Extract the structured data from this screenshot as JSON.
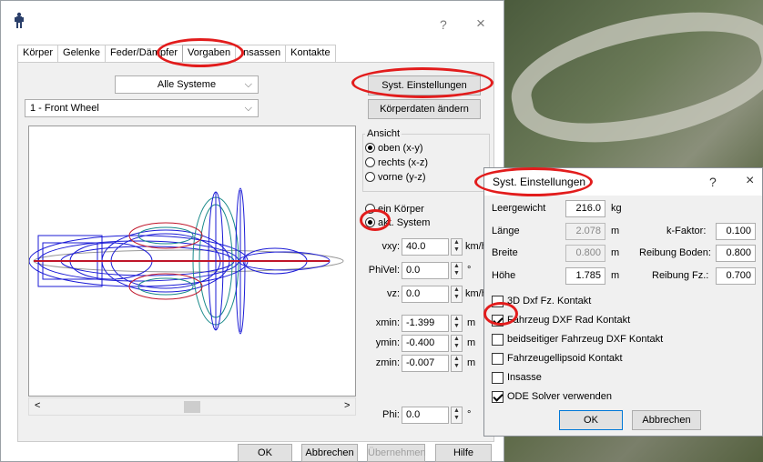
{
  "main_window": {
    "title_help": "?",
    "title_close": "×",
    "tabs": [
      "Körper",
      "Gelenke",
      "Feder/Dämpfer",
      "Vorgaben",
      "Insassen",
      "Kontakte"
    ],
    "active_tab": "Vorgaben",
    "system_select": "Alle Systeme",
    "body_select": "1 - Front Wheel",
    "syst_settings_button": "Syst. Einstellungen",
    "body_data_button": "Körperdaten ändern",
    "view_group": {
      "title": "Ansicht",
      "options": [
        "oben (x-y)",
        "rechts (x-z)",
        "vorne (y-z)"
      ],
      "selected": "oben (x-y)"
    },
    "scope_options": [
      "ein Körper",
      "akt. System"
    ],
    "scope_selected": "akt. System",
    "fields": {
      "vxy": {
        "label": "vxy:",
        "value": "40.0",
        "unit": "km/h"
      },
      "phivel": {
        "label": "PhiVel:",
        "value": "0.0",
        "unit": "°"
      },
      "vz": {
        "label": "vz:",
        "value": "0.0",
        "unit": "km/h"
      },
      "xmin": {
        "label": "xmin:",
        "value": "-1.399",
        "unit": "m"
      },
      "ymin": {
        "label": "ymin:",
        "value": "-0.400",
        "unit": "m"
      },
      "zmin": {
        "label": "zmin:",
        "value": "-0.007",
        "unit": "m"
      },
      "phi": {
        "label": "Phi:",
        "value": "0.0",
        "unit": "°"
      }
    },
    "scroll_left": "<",
    "scroll_right": ">",
    "footer_buttons": {
      "ok": "OK",
      "cancel": "Abbrechen",
      "apply": "Übernehmen",
      "help": "Hilfe"
    }
  },
  "dialog": {
    "title": "Syst. Einstellungen",
    "help": "?",
    "close": "×",
    "leergewicht": {
      "label": "Leergewicht",
      "value": "216.0",
      "unit": "kg"
    },
    "laenge": {
      "label": "Länge",
      "value": "2.078",
      "unit": "m"
    },
    "breite": {
      "label": "Breite",
      "value": "0.800",
      "unit": "m"
    },
    "hoehe": {
      "label": "Höhe",
      "value": "1.785",
      "unit": "m"
    },
    "k_faktor": {
      "label": "k-Faktor:",
      "value": "0.100"
    },
    "reibung_boden": {
      "label": "Reibung Boden:",
      "value": "0.800"
    },
    "reibung_fz": {
      "label": "Reibung Fz.:",
      "value": "0.700"
    },
    "checkboxes": [
      {
        "label": "3D Dxf Fz. Kontakt",
        "checked": false
      },
      {
        "label": "Fahrzeug DXF Rad Kontakt",
        "checked": true
      },
      {
        "label": "beidseitiger Fahrzeug DXF Kontakt",
        "checked": false
      },
      {
        "label": "Fahrzeugellipsoid Kontakt",
        "checked": false
      },
      {
        "label": "Insasse",
        "checked": false
      },
      {
        "label": "ODE Solver verwenden",
        "checked": true
      }
    ],
    "ok": "OK",
    "cancel": "Abbrechen"
  },
  "colors": {
    "annotation_red": "#e21c1c",
    "wire_blue": "#1b1bd6",
    "wire_teal": "#1a8a8a",
    "wire_red": "#c0162a"
  }
}
